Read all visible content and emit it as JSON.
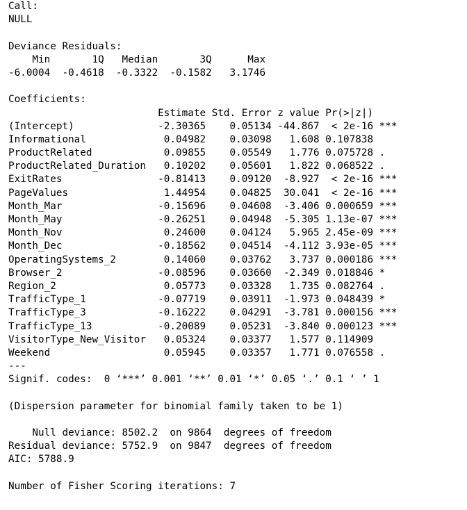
{
  "call": {
    "label": "Call:",
    "value": "NULL"
  },
  "deviance_residuals": {
    "title": "Deviance Residuals:",
    "header": "    Min       1Q   Median       3Q      Max  ",
    "values": "-6.0004  -0.4618  -0.3322  -0.1582   3.1746  "
  },
  "coefficients": {
    "title": "Coefficients:",
    "header": "                         Estimate Std. Error z value Pr(>|z|)    ",
    "rows": [
      "(Intercept)              -2.30365    0.05134 -44.867  < 2e-16 ***",
      "Informational             0.04982    0.03098   1.608 0.107838    ",
      "ProductRelated            0.09855    0.05549   1.776 0.075728 .  ",
      "ProductRelated_Duration   0.10202    0.05601   1.822 0.068522 .  ",
      "ExitRates                -0.81413    0.09120  -8.927  < 2e-16 ***",
      "PageValues                1.44954    0.04825  30.041  < 2e-16 ***",
      "Month_Mar                -0.15696    0.04608  -3.406 0.000659 ***",
      "Month_May                -0.26251    0.04948  -5.305 1.13e-07 ***",
      "Month_Nov                 0.24600    0.04124   5.965 2.45e-09 ***",
      "Month_Dec                -0.18562    0.04514  -4.112 3.93e-05 ***",
      "OperatingSystems_2        0.14060    0.03762   3.737 0.000186 ***",
      "Browser_2                -0.08596    0.03660  -2.349 0.018846 *  ",
      "Region_2                  0.05773    0.03328   1.735 0.082764 .  ",
      "TrafficType_1            -0.07719    0.03911  -1.973 0.048439 *  ",
      "TrafficType_3            -0.16222    0.04291  -3.781 0.000156 ***",
      "TrafficType_13           -0.20089    0.05231  -3.840 0.000123 ***",
      "VisitorType_New_Visitor   0.05324    0.03377   1.577 0.114909    ",
      "Weekend                   0.05945    0.03357   1.771 0.076558 .  "
    ]
  },
  "signif": {
    "separator": "---",
    "codes": "Signif. codes:  0 ‘***’ 0.001 ‘**’ 0.01 ‘*’ 0.05 ‘.’ 0.1 ‘ ’ 1"
  },
  "dispersion": "(Dispersion parameter for binomial family taken to be 1)",
  "deviance": {
    "null": "    Null deviance: 8502.2  on 9864  degrees of freedom",
    "residual": "Residual deviance: 5752.9  on 9847  degrees of freedom",
    "aic": "AIC: 5788.9"
  },
  "fisher": "Number of Fisher Scoring iterations: 7"
}
